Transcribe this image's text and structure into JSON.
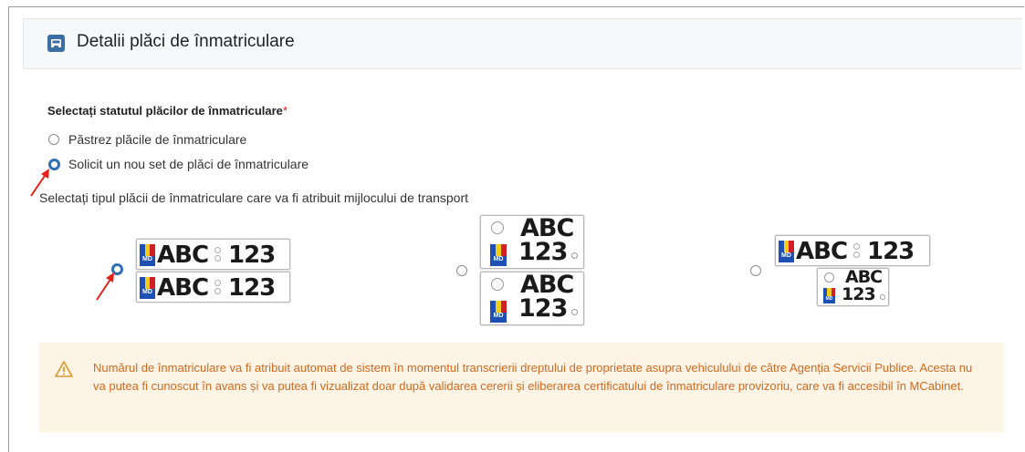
{
  "section": {
    "title": "Detalii plăci de înmatriculare",
    "icon": "car-icon",
    "accent": "#3a6ea5"
  },
  "status_question": {
    "label": "Selectați statutul plăcilor de înmatriculare",
    "required_mark": "*",
    "options": [
      {
        "label": "Păstrez plăcile de înmatriculare",
        "selected": false
      },
      {
        "label": "Solicit un nou set de plăci de înmatriculare",
        "selected": true
      }
    ]
  },
  "plate_type": {
    "label": "Selectați tipul plăcii de înmatriculare care va fi atribuit mijlocului de transport",
    "selected_index": 0,
    "plate_letters": "ABC",
    "plate_numbers": "123",
    "country_code": "MD"
  },
  "notice": {
    "icon": "warning-icon",
    "text": "Numărul de înmatriculare va fi atribuit automat de sistem în momentul transcrierii dreptului de proprietate asupra vehiculului de către Agenția Servicii Publice. Acesta nu va putea fi cunoscut în avans și va putea fi vizualizat doar după validarea cererii și eliberarea certificatului de înmatriculare provizoriu, care va fi accesibil în MCabinet.",
    "color": "#d2691e",
    "background": "#fef4e6"
  },
  "annotation_color": "#e32119"
}
